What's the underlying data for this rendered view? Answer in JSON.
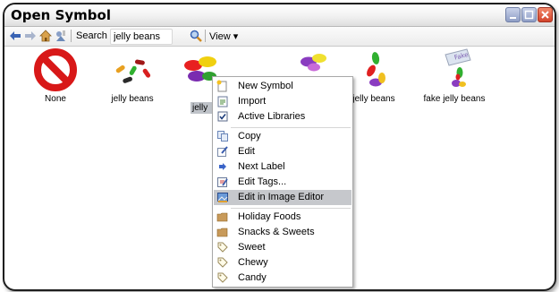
{
  "window": {
    "title": "Open Symbol"
  },
  "toolbar": {
    "search_label": "Search",
    "search_value": "jelly beans",
    "view_label": "View ▾"
  },
  "symbols": [
    {
      "label": "None",
      "icon": "no-symbol-icon"
    },
    {
      "label": "jelly beans",
      "icon": "jelly-beans-icon"
    },
    {
      "label": "jelly",
      "icon": "jelly-beans-pile-icon",
      "selected": true
    },
    {
      "label": "",
      "icon": "jelly-beans-cluster-icon"
    },
    {
      "label": "jelly beans",
      "icon": "jelly-beans-stack-icon"
    },
    {
      "label": "fake jelly beans",
      "icon": "fake-jelly-beans-icon"
    }
  ],
  "context_menu": {
    "items": [
      {
        "label": "New Symbol",
        "icon": "new-symbol-icon"
      },
      {
        "label": "Import",
        "icon": "import-icon"
      },
      {
        "label": "Active Libraries",
        "icon": "checkbox-icon"
      },
      {
        "label": "Copy",
        "icon": "copy-icon"
      },
      {
        "label": "Edit",
        "icon": "edit-icon"
      },
      {
        "label": "Next Label",
        "icon": "arrow-right-icon"
      },
      {
        "label": "Edit Tags...",
        "icon": "edit-tags-icon"
      },
      {
        "label": "Edit in Image Editor",
        "icon": "image-editor-icon",
        "highlighted": true
      },
      {
        "label": "Holiday Foods",
        "icon": "folder-icon"
      },
      {
        "label": "Snacks & Sweets",
        "icon": "folder-icon"
      },
      {
        "label": "Sweet",
        "icon": "tag-icon"
      },
      {
        "label": "Chewy",
        "icon": "tag-icon"
      },
      {
        "label": "Candy",
        "icon": "tag-icon"
      }
    ]
  },
  "colors": {
    "menu_highlight": "#c6c8cc",
    "close_button": "#d2432a",
    "window_buttons": "#8f9ec5"
  }
}
